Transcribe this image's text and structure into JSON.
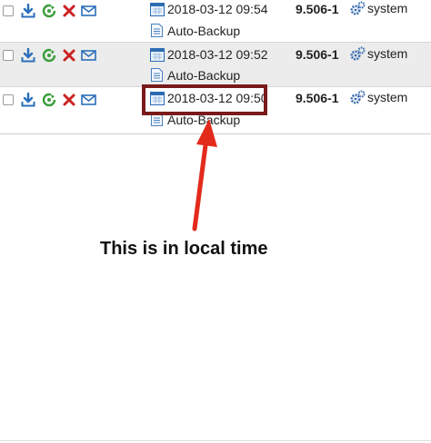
{
  "rows": [
    {
      "date": "2018-03-12 09:54",
      "note": "Auto-Backup",
      "version": "9.506-1",
      "user": "system"
    },
    {
      "date": "2018-03-12 09:52",
      "note": "Auto-Backup",
      "version": "9.506-1",
      "user": "system"
    },
    {
      "date": "2018-03-12 09:50",
      "note": "Auto-Backup",
      "version": "9.506-1",
      "user": "system"
    }
  ],
  "annotation": {
    "text": "This is in local time"
  },
  "colors": {
    "download": "#2a6fba",
    "restore": "#3b9e3b",
    "delete": "#cc2222",
    "email": "#2a6fba",
    "highlight": "#7a1a1a",
    "arrow": "#e32b1c",
    "row_alt_bg": "#ececec"
  },
  "icons": [
    "download-icon",
    "restore-icon",
    "delete-icon",
    "email-icon",
    "calendar-icon",
    "document-icon",
    "gears-icon"
  ]
}
